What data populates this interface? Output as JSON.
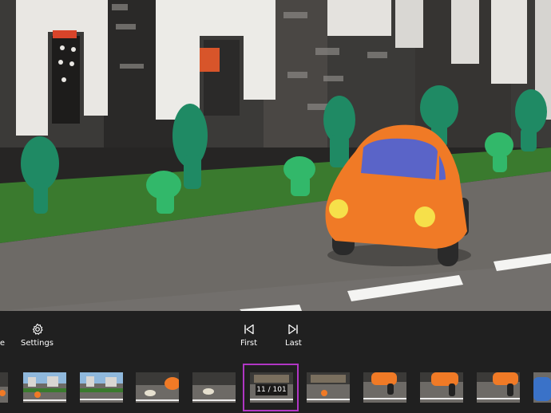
{
  "toolbar": {
    "partial_label": "e",
    "settings_label": "Settings",
    "first_label": "First",
    "last_label": "Last"
  },
  "icons": {
    "settings": "gear-icon",
    "first": "skip-to-first-icon",
    "last": "skip-to-last-icon"
  },
  "filmstrip": {
    "frame_counter": "11 / 101",
    "selected_border_color": "#b036c4"
  }
}
